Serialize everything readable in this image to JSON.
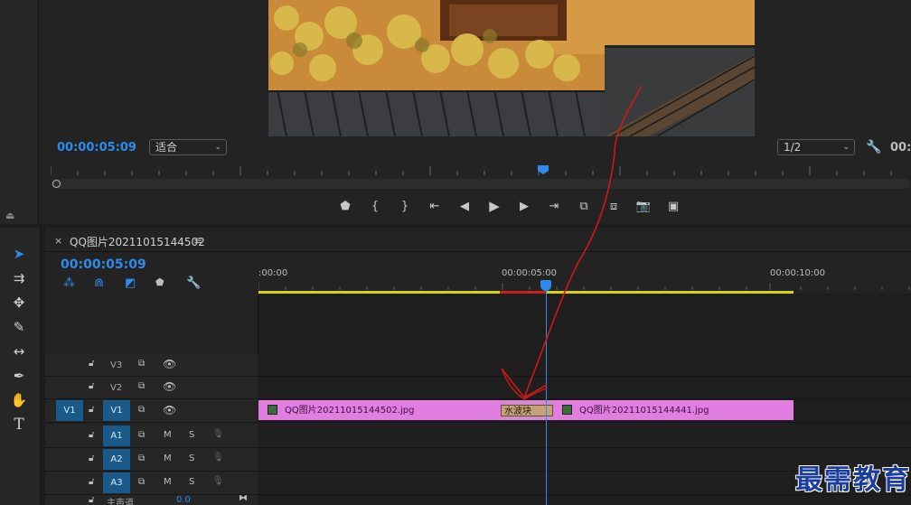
{
  "program_monitor": {
    "timecode": "00:00:05:09",
    "fit_label": "适合",
    "resolution_label": "1/2",
    "right_timecode": "00:"
  },
  "timeline": {
    "close_label": "×",
    "sequence_name": "QQ图片20211015144502",
    "menu_label": "≡",
    "timecode": "00:00:05:09",
    "ruler": {
      "start_label": ":00:00",
      "mid_label": "00:00:05:00",
      "end_label": "00:00:10:00"
    },
    "video_tracks": [
      {
        "name": "V3",
        "source_target": ""
      },
      {
        "name": "V2",
        "source_target": ""
      },
      {
        "name": "V1",
        "source_target": "V1"
      }
    ],
    "audio_tracks": [
      {
        "name": "A1",
        "mute": "M",
        "solo": "S"
      },
      {
        "name": "A2",
        "mute": "M",
        "solo": "S"
      },
      {
        "name": "A3",
        "mute": "M",
        "solo": "S"
      }
    ],
    "master_label": "主声道",
    "master_value": "0.0",
    "clips": [
      {
        "name": "QQ图片20211015144502.jpg"
      },
      {
        "name": "QQ图片20211015144441.jpg"
      }
    ],
    "transition_label": "水波块"
  },
  "watermark": "最需教育",
  "colors": {
    "accent_blue": "#2d8ceb",
    "clip_pink": "#e27de2",
    "work_area_yellow": "#d4d40e",
    "annotation_red": "#d01818"
  }
}
